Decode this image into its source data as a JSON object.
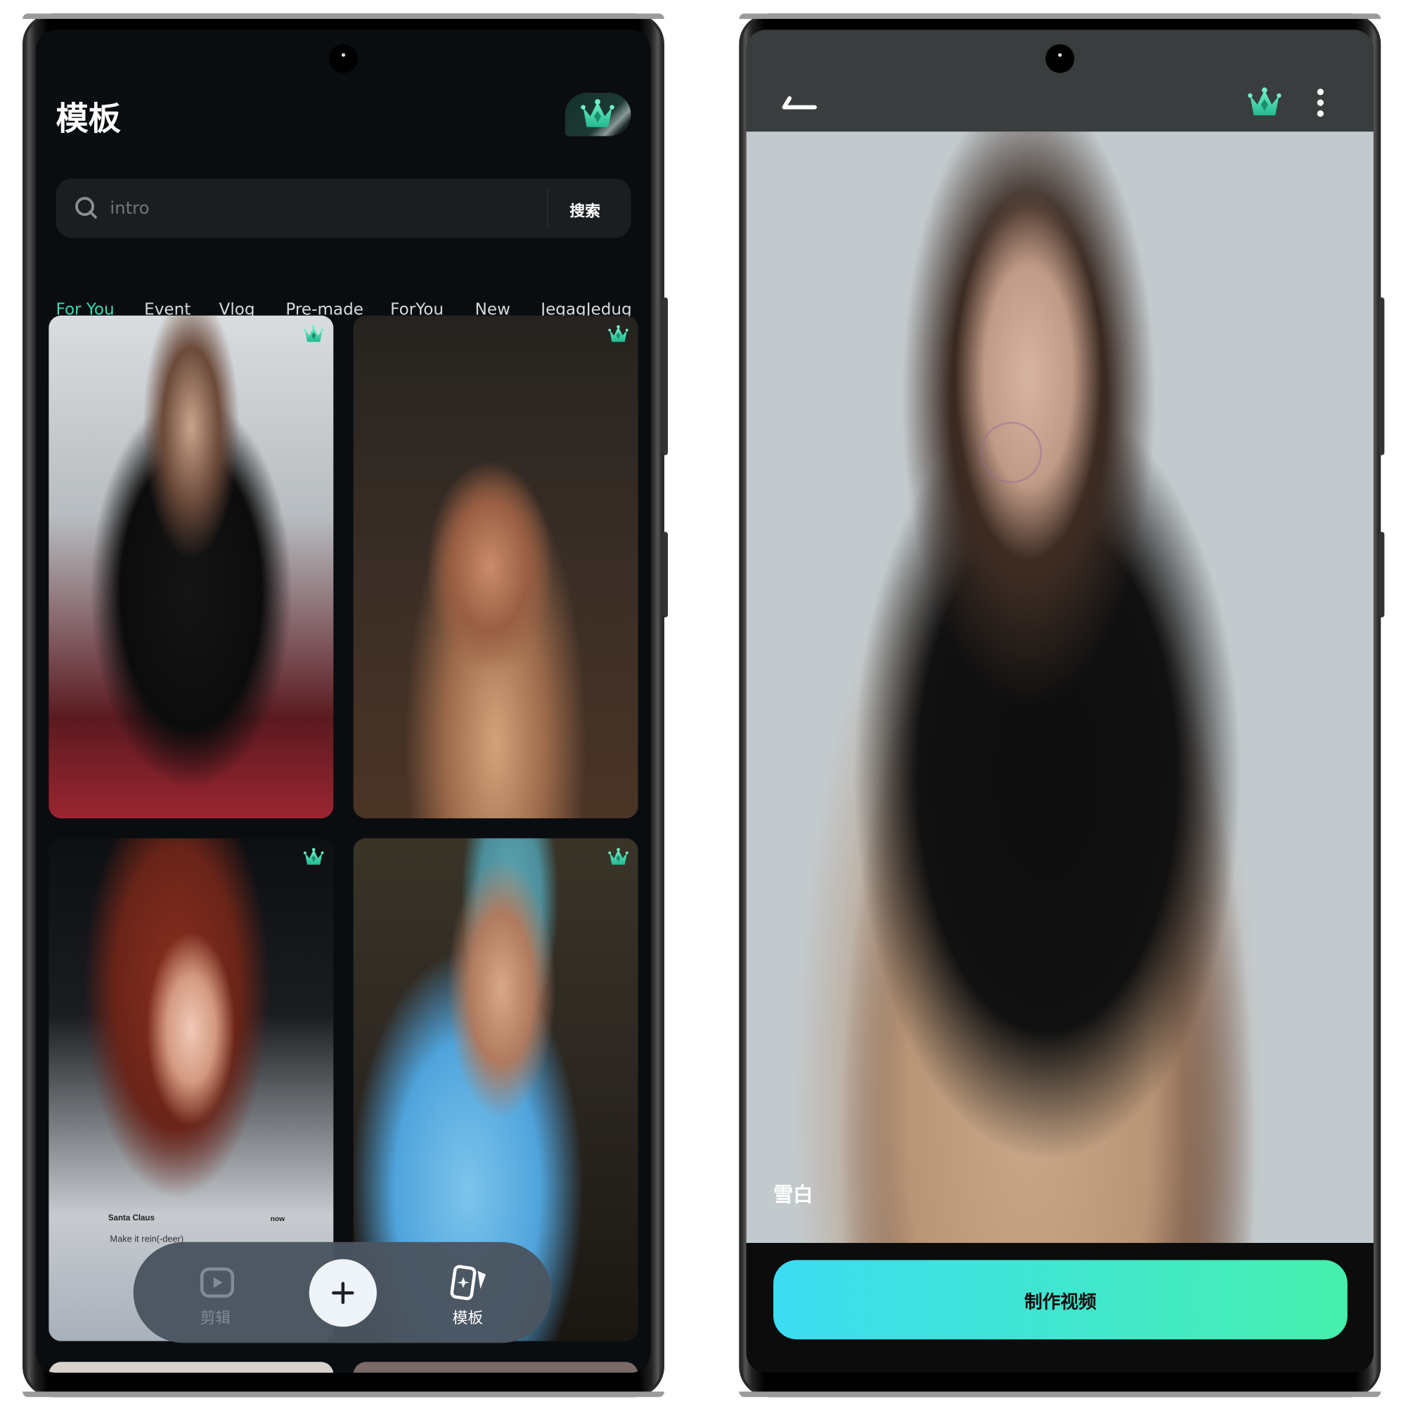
{
  "left_phone": {
    "header": {
      "title": "模板",
      "vip_icon": "crown-icon"
    },
    "search": {
      "placeholder": "intro",
      "button_label": "搜索",
      "icon": "search-icon"
    },
    "tabs": [
      {
        "label": "For You",
        "active": true
      },
      {
        "label": "Event",
        "active": false
      },
      {
        "label": "Vlog",
        "active": false
      },
      {
        "label": "Pre-made",
        "active": false
      },
      {
        "label": "ForYou",
        "active": false
      },
      {
        "label": "New",
        "active": false
      },
      {
        "label": "JegagJedug",
        "active": false
      }
    ],
    "cards": [
      {
        "premium": true
      },
      {
        "premium": true
      },
      {
        "premium": true,
        "overlay_notification": {
          "sender": "Santa Claus",
          "time": "now",
          "message": "Make it rein(-deer)"
        }
      },
      {
        "premium": true
      }
    ],
    "bottom_nav": {
      "items": [
        {
          "label": "剪辑",
          "icon": "play-square-icon",
          "active": false
        },
        {
          "label": "模板",
          "icon": "template-cards-icon",
          "active": true
        }
      ],
      "add_icon": "plus-icon"
    }
  },
  "right_phone": {
    "toolbar": {
      "back_icon": "back-arrow-icon",
      "vip_icon": "crown-icon",
      "more_icon": "more-vertical-icon"
    },
    "preview": {
      "caption": "雪白"
    },
    "cta": {
      "label": "制作视频"
    }
  },
  "colors": {
    "accent": "#3fd9b5",
    "background": "#0a0d10",
    "search_bg": "#1b1e21",
    "nav_pill": "#4a5560",
    "preview_bg": "#c3cacd",
    "toolbar_bg": "#3a3d3e",
    "cta_gradient_start": "#3cdcf2",
    "cta_gradient_end": "#45f0ad"
  }
}
